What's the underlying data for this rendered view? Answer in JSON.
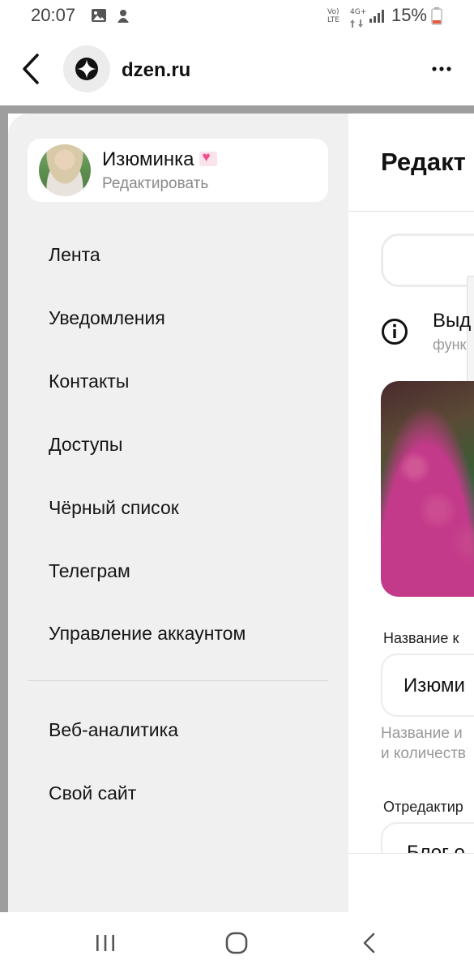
{
  "status_bar": {
    "time": "20:07",
    "battery": "15%",
    "volte_top": "Vo)",
    "volte_bottom": "LTE",
    "network": "4G+"
  },
  "browser": {
    "url": "dzen.ru"
  },
  "drawer": {
    "profile": {
      "name": "Изюминка",
      "edit_label": "Редактировать"
    },
    "menu_items": [
      "Лента",
      "Уведомления",
      "Контакты",
      "Доступы",
      "Чёрный список",
      "Телеграм",
      "Управление аккаунтом"
    ],
    "secondary_items": [
      "Веб-аналитика",
      "Свой сайт"
    ]
  },
  "background_page": {
    "title": "Редакт",
    "info_title": "Выд",
    "info_sub": "функ",
    "field1_label": "Название к",
    "field1_value": "Изюми",
    "hint_line1": "Название и",
    "hint_line2": "и количеств",
    "field2_label": "Отредактир",
    "field2_value": "Блог о"
  },
  "colors": {
    "drawer_bg": "#f0f0f0",
    "overlay_gray": "#9e9e9e",
    "accent_pink": "#f0508c"
  }
}
